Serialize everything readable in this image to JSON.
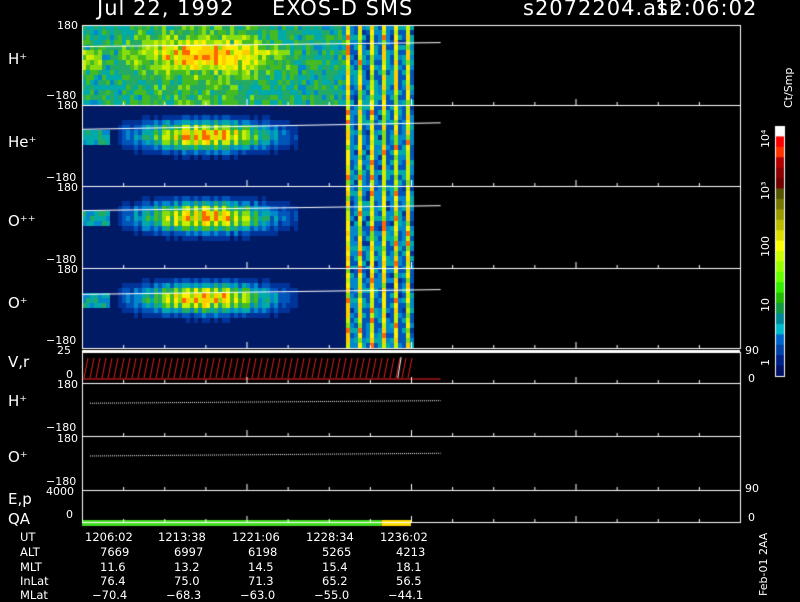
{
  "header": {
    "date": "Jul 22, 1992",
    "instrument": "EXOS-D SMS",
    "file": "s2072204.asr",
    "time": "12:06:02"
  },
  "colorbar": {
    "unit": "Ct/Smp",
    "labels": [
      "10⁴",
      "10³",
      "100",
      "10",
      "1"
    ],
    "colors": [
      "#ffffff",
      "#ff0000",
      "#ff3300",
      "#b30000",
      "#8b0000",
      "#700000",
      "#555500",
      "#777700",
      "#999900",
      "#bbbb00",
      "#dddd00",
      "#ffff00",
      "#ccff00",
      "#99ff00",
      "#66ff00",
      "#33ee00",
      "#22bb00",
      "#119944",
      "#008899",
      "#00bbcc",
      "#0066cc",
      "#0044aa",
      "#002288",
      "#001166"
    ]
  },
  "panels": [
    {
      "label": "H⁺",
      "top": "180",
      "bottom": "−180",
      "line_y": [
        0.27,
        0.22
      ]
    },
    {
      "label": "He⁺",
      "top": "180",
      "bottom": "−180",
      "line_y": [
        0.3,
        0.22
      ]
    },
    {
      "label": "O⁺⁺",
      "top": "180",
      "bottom": "−180",
      "line_y": [
        0.3,
        0.24
      ]
    },
    {
      "label": "O⁺",
      "top": "180",
      "bottom": "−180",
      "line_y": [
        0.33,
        0.27
      ]
    }
  ],
  "vr": {
    "label": "V,r",
    "top": "25",
    "bottom": "0",
    "right_top": "90",
    "right_bottom": "0"
  },
  "lines": [
    {
      "label": "H⁺",
      "top": "180",
      "bottom": "−180",
      "line_y": [
        0.37,
        0.32
      ]
    },
    {
      "label": "O⁺",
      "top": "180",
      "bottom": "−180",
      "line_y": [
        0.37,
        0.32
      ]
    }
  ],
  "ep": {
    "label": "E,p",
    "top": "4000",
    "right_top": "90"
  },
  "qa": {
    "label": "QA",
    "bottom": "0",
    "right_bottom": "0",
    "green_end": 0.455,
    "yellow_end": 0.5
  },
  "footer": {
    "rows": [
      {
        "name": "UT",
        "values": [
          "1206:02",
          "1213:38",
          "1221:06",
          "1228:34",
          "1236:02"
        ]
      },
      {
        "name": "ALT",
        "values": [
          "7669",
          "6997",
          "6198",
          "5265",
          "4213"
        ]
      },
      {
        "name": "MLT",
        "values": [
          "11.6",
          "13.2",
          "14.5",
          "15.4",
          "18.1"
        ]
      },
      {
        "name": "InLat",
        "values": [
          "76.4",
          "75.0",
          "71.3",
          "65.2",
          "56.5"
        ]
      },
      {
        "name": "MLat",
        "values": [
          "−70.4",
          "−68.3",
          "−63.0",
          "−55.0",
          "−44.1"
        ]
      }
    ],
    "stamp": "Feb-01 2AA"
  },
  "chart_data": {
    "type": "heatmap",
    "title": "Jul 22, 1992 EXOS-D SMS",
    "x_ticks": [
      "1206:02",
      "1213:38",
      "1221:06",
      "1228:34",
      "1236:02"
    ],
    "data_end_fraction": 0.5,
    "y_range": [
      -180,
      180
    ],
    "colorbar_range": [
      1,
      10000
    ],
    "colorbar_scale": "log"
  }
}
